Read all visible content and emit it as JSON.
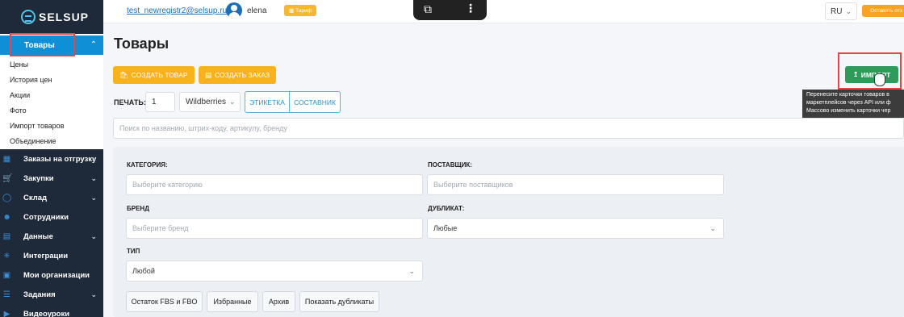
{
  "sidebar": {
    "logo_text": "SELSUP",
    "active_item": {
      "label": "Товары"
    },
    "sub_items": [
      {
        "label": "Цены"
      },
      {
        "label": "История цен"
      },
      {
        "label": "Акции"
      },
      {
        "label": "Фото"
      },
      {
        "label": "Импорт товаров"
      },
      {
        "label": "Объединение"
      }
    ],
    "items": [
      {
        "label": "Заказы на отгрузку",
        "icon": "orders-icon"
      },
      {
        "label": "Закупки",
        "icon": "cart-icon"
      },
      {
        "label": "Склад",
        "icon": "warehouse-icon"
      },
      {
        "label": "Сотрудники",
        "icon": "user-icon"
      },
      {
        "label": "Данные",
        "icon": "data-icon"
      },
      {
        "label": "Интеграции",
        "icon": "integrations-icon"
      },
      {
        "label": "Мои организации",
        "icon": "org-icon"
      },
      {
        "label": "Задания",
        "icon": "tasks-icon"
      },
      {
        "label": "Видеоуроки",
        "icon": "video-icon"
      }
    ]
  },
  "topbar": {
    "email": "test_newregistr2@selsup.ru",
    "username": "elena",
    "tariff_label": "Тариф",
    "lang": "RU",
    "feedback_label": "Оставить отз"
  },
  "page": {
    "title": "Товары",
    "create_product_label": "СОЗДАТЬ ТОВАР",
    "create_order_label": "СОЗДАТЬ ЗАКАЗ",
    "import_label": "ИМПОРТ",
    "tooltip_lines": [
      "Перенесите карточки товаров в",
      "маркетплейсов через API или ф",
      "Массово изменить карточки чер"
    ],
    "print_label": "ПЕЧАТЬ:",
    "print_count": "1",
    "marketplace": "Wildberries",
    "label_button": "ЭТИКЕТКА",
    "composite_button": "СОСТАВНИК",
    "search_placeholder": "Поиск по названию, штрих-коду, артикулу, бренду"
  },
  "filters": {
    "category_label": "КАТЕГОРИЯ:",
    "category_placeholder": "Выберите категорию",
    "supplier_label": "ПОСТАВЩИК:",
    "supplier_placeholder": "Выберите поставщиков",
    "brand_label": "БРЕНД",
    "brand_placeholder": "Выберите бренд",
    "duplicate_label": "ДУБЛИКАТ:",
    "duplicate_value": "Любые",
    "type_label": "ТИП",
    "type_value": "Любой",
    "chips": [
      {
        "label": "Остаток FBS и FBO"
      },
      {
        "label": "Избранные"
      },
      {
        "label": "Архив"
      },
      {
        "label": "Показать дубликаты"
      }
    ]
  },
  "colors": {
    "sidebar_dark": "#1e2a3a",
    "active_blue": "#0e8fd6",
    "orange": "#f8b21c",
    "green": "#2e9b5a",
    "highlight_red": "#e4473f"
  }
}
